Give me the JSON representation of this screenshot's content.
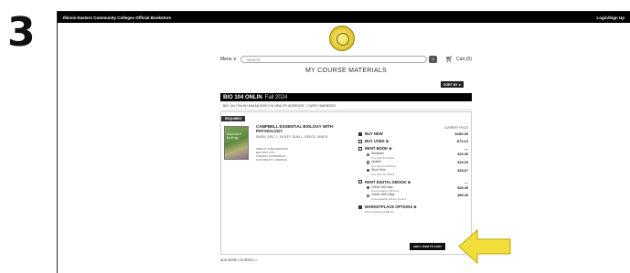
{
  "step": "3",
  "topbar": {
    "store_name": "Illinois Eastern Community Colleges Official Bookstore",
    "login": "Login/Sign Up"
  },
  "nav": {
    "menu_label": "Menu ∨",
    "search_placeholder": "Search",
    "cart_label": "Cart (0)"
  },
  "page_title": "MY COURSE MATERIALS",
  "sort_by": "SORT BY ∨",
  "course": {
    "code": "BIO 104 ONLIN",
    "term": "Fall 2024",
    "subtitle": "BIO 104 ONLIN HUMAN BODY IN HEALTH &DISEASE - CAREY BABIENCE"
  },
  "required_tag": "REQUIRED",
  "book": {
    "cover_text": "essential biology",
    "title": "CAMPBELL ESSENTIAL BIOLOGY WITH PHYSIOLOGY",
    "authors": "SIMON, ERIC J.; DICKEY, JEAN L.; REECE, JANE B.",
    "meta": [
      "ISBN13: 9780134053318",
      "EDITION: 6TH",
      "FORMAT: PAPERBACK",
      "COPYRIGHT: 1/30/2018"
    ]
  },
  "options": {
    "price_header": "CURRENT PRICE",
    "buy_new": {
      "label": "BUY NEW",
      "price": "$189.35"
    },
    "buy_used": {
      "label": "BUY USED ⊕",
      "price": "$73.13"
    },
    "rent_book": {
      "label": "RENT BOOK ⊕",
      "price": "—",
      "items": [
        {
          "label": "Semester",
          "note": "Due back 8/31/2024",
          "price": "$20.30"
        },
        {
          "label": "Quarter",
          "note": "Due back 12/10/2024",
          "price": "$29.29"
        },
        {
          "label": "Short Term",
          "note": "Due back 11/7/2024",
          "price": "$28.67"
        }
      ]
    },
    "rent_ebook": {
      "label": "RENT DIGITAL EBOOK ⊕",
      "price": "—",
      "items": [
        {
          "label": "Online 180 Days",
          "note": "Downloadable 180 Days",
          "price": "$49.49"
        },
        {
          "label": "Online 1800 Days",
          "note": "Downloadable Lifetime Access",
          "price": "$80.49"
        }
      ]
    },
    "marketplace": {
      "label": "MARKETPLACE OPTIONS ⊕",
      "note": "Prices starting at $40.40"
    }
  },
  "add_button": "ADD 1 ITEM TO CART",
  "add_more": "ADD MORE COURSES >>",
  "colors": {
    "arrow": "#f2de3a",
    "arrow_outline": "#c9b21d",
    "header_bg": "#000000"
  }
}
